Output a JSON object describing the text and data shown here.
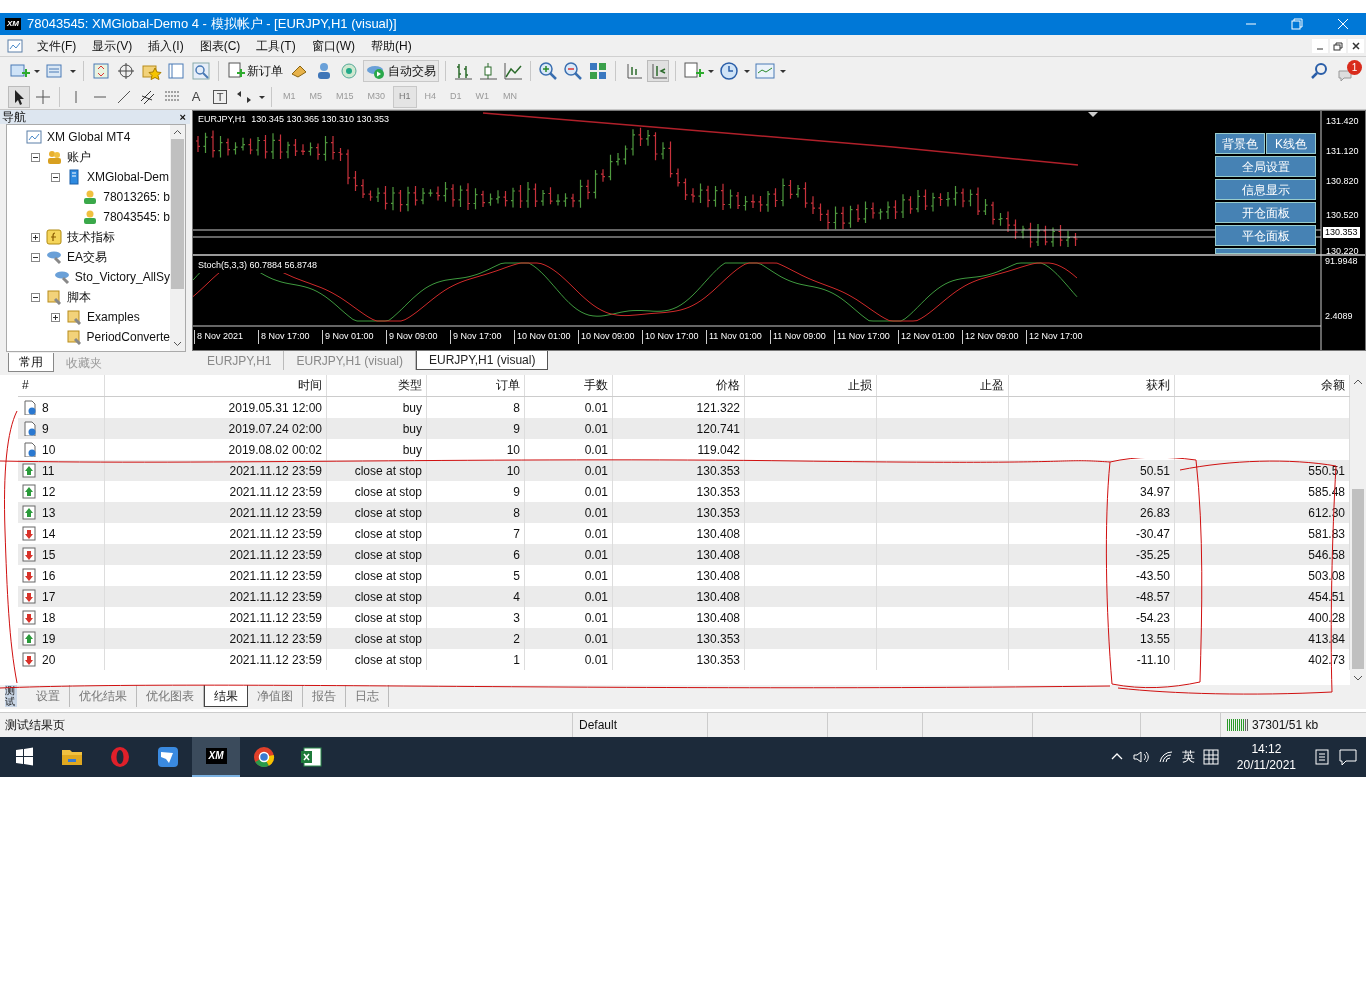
{
  "window": {
    "title": "78043545: XMGlobal-Demo 4 - 模拟帐户 - [EURJPY,H1 (visual)]",
    "app_badge": "XM"
  },
  "menu": [
    "文件(F)",
    "显示(V)",
    "插入(I)",
    "图表(C)",
    "工具(T)",
    "窗口(W)",
    "帮助(H)"
  ],
  "toolbar": {
    "new_order": "新订单",
    "auto_trading": "自动交易",
    "notification_count": "1",
    "text_tool": "A",
    "label_tool": "T"
  },
  "timeframes": [
    {
      "label": "M1",
      "selected": false
    },
    {
      "label": "M5",
      "selected": false
    },
    {
      "label": "M15",
      "selected": false
    },
    {
      "label": "M30",
      "selected": false
    },
    {
      "label": "H1",
      "selected": true
    },
    {
      "label": "H4",
      "selected": false
    },
    {
      "label": "D1",
      "selected": false
    },
    {
      "label": "W1",
      "selected": false
    },
    {
      "label": "MN",
      "selected": false
    }
  ],
  "navigator": {
    "title": "导航",
    "close": "×",
    "tree": [
      {
        "label": "XM Global MT4",
        "kind": "root",
        "children": [
          {
            "label": "账户",
            "kind": "accounts",
            "expanded": true,
            "children": [
              {
                "label": "XMGlobal-Dem",
                "kind": "server",
                "expanded": true,
                "children": [
                  {
                    "label": "78013265: b",
                    "kind": "user"
                  },
                  {
                    "label": "78043545: b",
                    "kind": "user"
                  }
                ]
              }
            ]
          },
          {
            "label": "技术指标",
            "kind": "indicator",
            "expanded": false
          },
          {
            "label": "EA交易",
            "kind": "ea",
            "expanded": true,
            "children": [
              {
                "label": "Sto_Victory_AllSy",
                "kind": "ea"
              }
            ]
          },
          {
            "label": "脚本",
            "kind": "script",
            "expanded": true,
            "children": [
              {
                "label": "Examples",
                "kind": "script",
                "expanded": false
              },
              {
                "label": "PeriodConverte",
                "kind": "script"
              }
            ]
          }
        ]
      }
    ],
    "tabs": [
      {
        "label": "常用",
        "selected": true
      },
      {
        "label": "收藏夹",
        "selected": false
      }
    ]
  },
  "chart": {
    "header": "EURJPY,H1  130.345 130.365 130.310 130.353",
    "indicator_header": "Stoch(5,3,3) 60.7884 56.8748",
    "price_labels": [
      "131.420",
      "131.120",
      "130.820",
      "130.520",
      "130.220"
    ],
    "current_price": "130.353",
    "indicator_labels": [
      "91.9948",
      "2.4089"
    ],
    "time_labels": [
      "8 Nov 2021",
      "8 Nov 17:00",
      "9 Nov 01:00",
      "9 Nov 09:00",
      "9 Nov 17:00",
      "10 Nov 01:00",
      "10 Nov 09:00",
      "10 Nov 17:00",
      "11 Nov 01:00",
      "11 Nov 09:00",
      "11 Nov 17:00",
      "12 Nov 01:00",
      "12 Nov 09:00",
      "12 Nov 17:00"
    ],
    "panel_buttons": [
      [
        "背景色",
        "K线色"
      ],
      [
        "全局设置"
      ],
      [
        "信息显示"
      ],
      [
        "开仓面板"
      ],
      [
        "平仓面板"
      ]
    ]
  },
  "chart_tabs": [
    {
      "label": "EURJPY,H1",
      "selected": false
    },
    {
      "label": "EURJPY,H1 (visual)",
      "selected": false
    },
    {
      "label": "EURJPY,H1 (visual)",
      "selected": true
    }
  ],
  "table": {
    "columns": [
      "#",
      "时间",
      "类型",
      "订单",
      "手数",
      "价格",
      "止损",
      "止盈",
      "获利",
      "余额"
    ],
    "rows": [
      {
        "kind": "pending",
        "cells": [
          "8",
          "2019.05.31 12:00",
          "buy",
          "8",
          "0.01",
          "121.322",
          "",
          "",
          "",
          ""
        ]
      },
      {
        "kind": "pending",
        "cells": [
          "9",
          "2019.07.24 02:00",
          "buy",
          "9",
          "0.01",
          "120.741",
          "",
          "",
          "",
          ""
        ]
      },
      {
        "kind": "pending",
        "cells": [
          "10",
          "2019.08.02 00:02",
          "buy",
          "10",
          "0.01",
          "119.042",
          "",
          "",
          "",
          ""
        ]
      },
      {
        "kind": "up",
        "cells": [
          "11",
          "2021.11.12 23:59",
          "close at stop",
          "10",
          "0.01",
          "130.353",
          "",
          "",
          "50.51",
          "550.51"
        ]
      },
      {
        "kind": "up",
        "cells": [
          "12",
          "2021.11.12 23:59",
          "close at stop",
          "9",
          "0.01",
          "130.353",
          "",
          "",
          "34.97",
          "585.48"
        ]
      },
      {
        "kind": "up",
        "cells": [
          "13",
          "2021.11.12 23:59",
          "close at stop",
          "8",
          "0.01",
          "130.353",
          "",
          "",
          "26.83",
          "612.30"
        ]
      },
      {
        "kind": "down",
        "cells": [
          "14",
          "2021.11.12 23:59",
          "close at stop",
          "7",
          "0.01",
          "130.408",
          "",
          "",
          "-30.47",
          "581.83"
        ]
      },
      {
        "kind": "down",
        "cells": [
          "15",
          "2021.11.12 23:59",
          "close at stop",
          "6",
          "0.01",
          "130.408",
          "",
          "",
          "-35.25",
          "546.58"
        ]
      },
      {
        "kind": "down",
        "cells": [
          "16",
          "2021.11.12 23:59",
          "close at stop",
          "5",
          "0.01",
          "130.408",
          "",
          "",
          "-43.50",
          "503.08"
        ]
      },
      {
        "kind": "down",
        "cells": [
          "17",
          "2021.11.12 23:59",
          "close at stop",
          "4",
          "0.01",
          "130.408",
          "",
          "",
          "-48.57",
          "454.51"
        ]
      },
      {
        "kind": "down",
        "cells": [
          "18",
          "2021.11.12 23:59",
          "close at stop",
          "3",
          "0.01",
          "130.408",
          "",
          "",
          "-54.23",
          "400.28"
        ]
      },
      {
        "kind": "up",
        "cells": [
          "19",
          "2021.11.12 23:59",
          "close at stop",
          "2",
          "0.01",
          "130.353",
          "",
          "",
          "13.55",
          "413.84"
        ]
      },
      {
        "kind": "down",
        "cells": [
          "20",
          "2021.11.12 23:59",
          "close at stop",
          "1",
          "0.01",
          "130.353",
          "",
          "",
          "-11.10",
          "402.73"
        ]
      }
    ]
  },
  "terminal": {
    "side_label": "测试",
    "tabs": [
      {
        "label": "设置",
        "selected": false
      },
      {
        "label": "优化结果",
        "selected": false
      },
      {
        "label": "优化图表",
        "selected": false
      },
      {
        "label": "结果",
        "selected": true
      },
      {
        "label": "净值图",
        "selected": false
      },
      {
        "label": "报告",
        "selected": false
      },
      {
        "label": "日志",
        "selected": false
      }
    ]
  },
  "status_bar": {
    "message": "测试结果页",
    "profile": "Default",
    "traffic": "37301/51 kb"
  },
  "taskbar": {
    "app_badge": "XM",
    "input_method": "英",
    "time": "14:12",
    "date": "20/11/2021"
  }
}
